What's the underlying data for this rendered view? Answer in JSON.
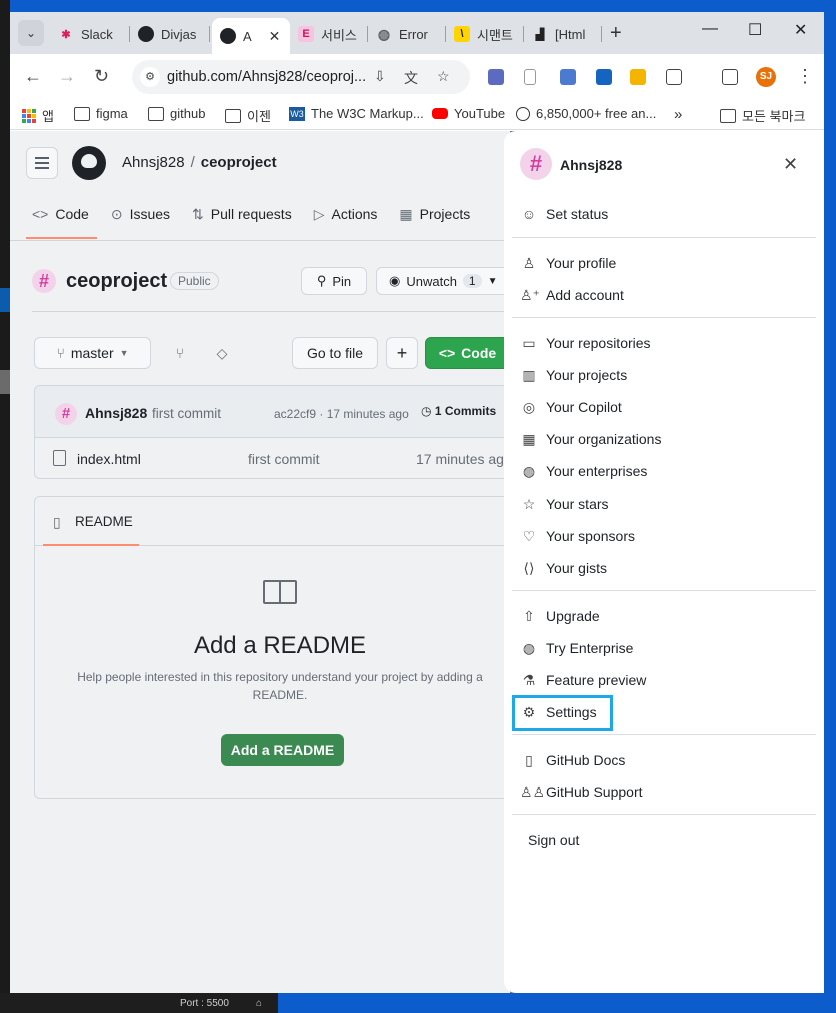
{
  "browser": {
    "tabs": [
      {
        "label": "Slack",
        "icon_color": "#e01e5a"
      },
      {
        "label": "Divjas",
        "icon_color": "#1f2328"
      },
      {
        "label": "A",
        "icon_color": "#1f2328",
        "active": true
      },
      {
        "label": "서비스",
        "icon_color": "#e75fa7"
      },
      {
        "label": "Error",
        "icon_color": "#5f6368"
      },
      {
        "label": "시맨트",
        "icon_color": "#ffd400"
      },
      {
        "label": "[Html",
        "icon_color": "#222"
      }
    ],
    "url": "github.com/Ahnsj828/ceoproj...",
    "profile_initials": "SJ",
    "bookmarks": [
      {
        "label": "앱"
      },
      {
        "label": "figma"
      },
      {
        "label": "github"
      },
      {
        "label": "이젠"
      },
      {
        "label": "The W3C Markup..."
      },
      {
        "label": "YouTube"
      },
      {
        "label": "6,850,000+ free an..."
      },
      {
        "label": "모든 북마크"
      }
    ]
  },
  "repo": {
    "owner": "Ahnsj828",
    "name": "ceoproject",
    "visibility": "Public",
    "nav": [
      "Code",
      "Issues",
      "Pull requests",
      "Actions",
      "Projects"
    ],
    "pin_label": "Pin",
    "watch_label": "Unwatch",
    "watch_count": "1",
    "branch": "master",
    "go_to_file": "Go to file",
    "add_label": "+",
    "code_label": "Code",
    "commit": {
      "author": "Ahnsj828",
      "message": "first commit",
      "hash_time": "ac22cf9 · 17 minutes ago",
      "count": "1 Commits"
    },
    "files": [
      {
        "name": "index.html",
        "message": "first commit",
        "date": "17 minutes ago"
      }
    ],
    "readme": {
      "tab": "README",
      "title": "Add a README",
      "description": "Help people interested in this repository understand your project by adding a README.",
      "button": "Add a README"
    }
  },
  "menu": {
    "username": "Ahnsj828",
    "items": [
      {
        "label": "Set status"
      },
      {
        "label": "Your profile"
      },
      {
        "label": "Add account"
      },
      {
        "label": "Your repositories"
      },
      {
        "label": "Your projects"
      },
      {
        "label": "Your Copilot"
      },
      {
        "label": "Your organizations"
      },
      {
        "label": "Your enterprises"
      },
      {
        "label": "Your stars"
      },
      {
        "label": "Your sponsors"
      },
      {
        "label": "Your gists"
      },
      {
        "label": "Upgrade"
      },
      {
        "label": "Try Enterprise"
      },
      {
        "label": "Feature preview"
      },
      {
        "label": "Settings"
      },
      {
        "label": "GitHub Docs"
      },
      {
        "label": "GitHub Support"
      },
      {
        "label": "Sign out"
      }
    ],
    "highlight_color": "#1ea8e8"
  },
  "desktop": {
    "status_port": "Port : 5500"
  }
}
